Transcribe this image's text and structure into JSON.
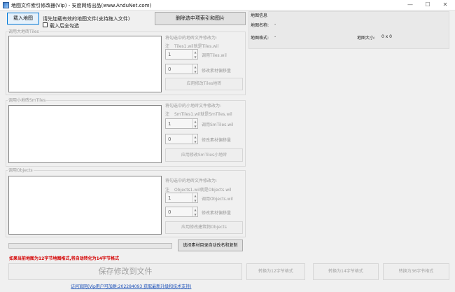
{
  "window": {
    "title": "地图文件索引修改器(Vip) - 安度网络出品(www.AnduNet.com)",
    "minimize_glyph": "—",
    "maximize_glyph": "☐",
    "close_glyph": "✕"
  },
  "toolbar": {
    "load_map_label": "载入地图",
    "hint_text": "请先加载有效的地图文件(支持拖入文件)",
    "load_select_all_label": "载入后全勾选",
    "delete_selected_label": "删除选中项索引和图片"
  },
  "tiles": {
    "group_label": "调用大地砖Tiles",
    "rename_label": "将勾选中的地砖文件修改为:",
    "hint_prefix": "注",
    "hint_text": "Tiles1.wil就是Tiles.wil",
    "spin_value": "1",
    "spin_label": "调用Tiles.wil",
    "offset_value": "0",
    "offset_label": "修改素材偏移量",
    "apply_label": "应用修改Tiles地砖"
  },
  "smtiles": {
    "group_label": "调用小地砖SmTiles",
    "rename_label": "将勾选中的小地砖文件修改为:",
    "hint_prefix": "注",
    "hint_text": "SmTiles1.wil就是SmTiles.wil",
    "spin_value": "1",
    "spin_label": "调用SmTiles.wil",
    "offset_value": "0",
    "offset_label": "修改素材偏移量",
    "apply_label": "应用修改SmTiles小地砖"
  },
  "objects": {
    "group_label": "调用Objects",
    "rename_label": "将勾选中的地砖文件修改为:",
    "hint_prefix": "注",
    "hint_text": "Objects1.wil就是Objects.wil",
    "spin_value": "1",
    "spin_label": "调用Objects.wil",
    "offset_value": "0",
    "offset_label": "修改素材偏移量",
    "apply_label": "应用修改建筑物Objects"
  },
  "bottom": {
    "copy_materials_label": "选择素材目录自动改名和复制",
    "warning_text": "如果当前地图为12字节地图格式,将自动转化为14字节格式",
    "save_label": "保存修改到文件",
    "convert_12_label": "转换为12字节格式",
    "convert_14_label": "转换为14字节格式",
    "convert_36_label": "转换为36字节格式",
    "link_text": "访问官网(Vip用户可加群:202284093 获取最新升级和技术支持)"
  },
  "map_info": {
    "title": "地图信息",
    "name_label": "地图名称:",
    "name_value": "-",
    "format_label": "地图格式:",
    "format_value": "-",
    "size_label": "地图大小:",
    "size_value": "0 x 0"
  },
  "colors": {
    "warning": "#d40000",
    "link": "#1a4fb7",
    "accent_border": "#0078d7"
  }
}
